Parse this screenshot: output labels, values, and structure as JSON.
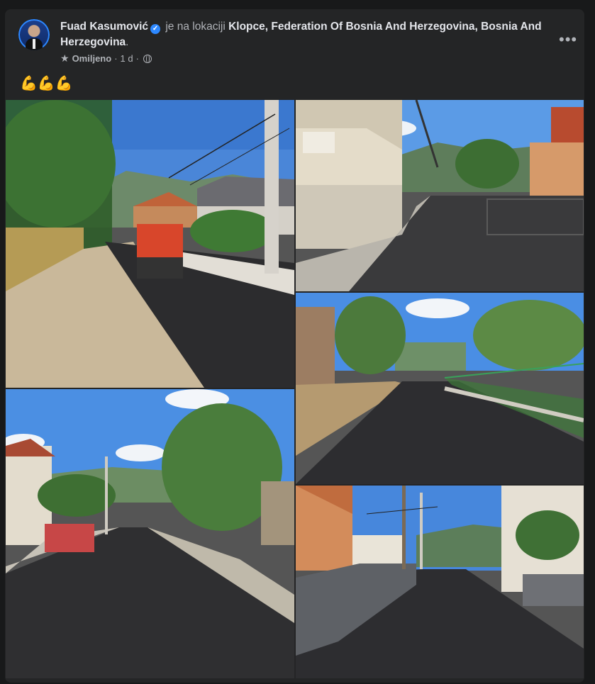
{
  "post": {
    "author": "Fuad Kasumović",
    "at_location_text": "je na lokaciji",
    "location": "Klopce, Federation Of Bosnia And Herzegovina, Bosnia And Herzegovina",
    "location_end": ".",
    "meta_favorites": "Omiljeno",
    "meta_sep": "·",
    "meta_time": "1 d",
    "meta_sep2": "·",
    "more_label": "•••",
    "body": "💪💪💪"
  },
  "icons": {
    "verified": "verified-badge-icon",
    "favorites": "star-icon",
    "audience": "globe-icon",
    "more": "more-options-icon"
  },
  "colors": {
    "background": "#18191a",
    "card": "#242526",
    "text": "#e4e6eb",
    "secondary_text": "#b0b3b8",
    "accent": "#2d88ff"
  },
  "photos": [
    {
      "id": "road-roller-photo"
    },
    {
      "id": "houses-street-photo"
    },
    {
      "id": "fence-road-photo"
    },
    {
      "id": "trees-road-photo"
    },
    {
      "id": "gray-fence-street-photo"
    }
  ]
}
